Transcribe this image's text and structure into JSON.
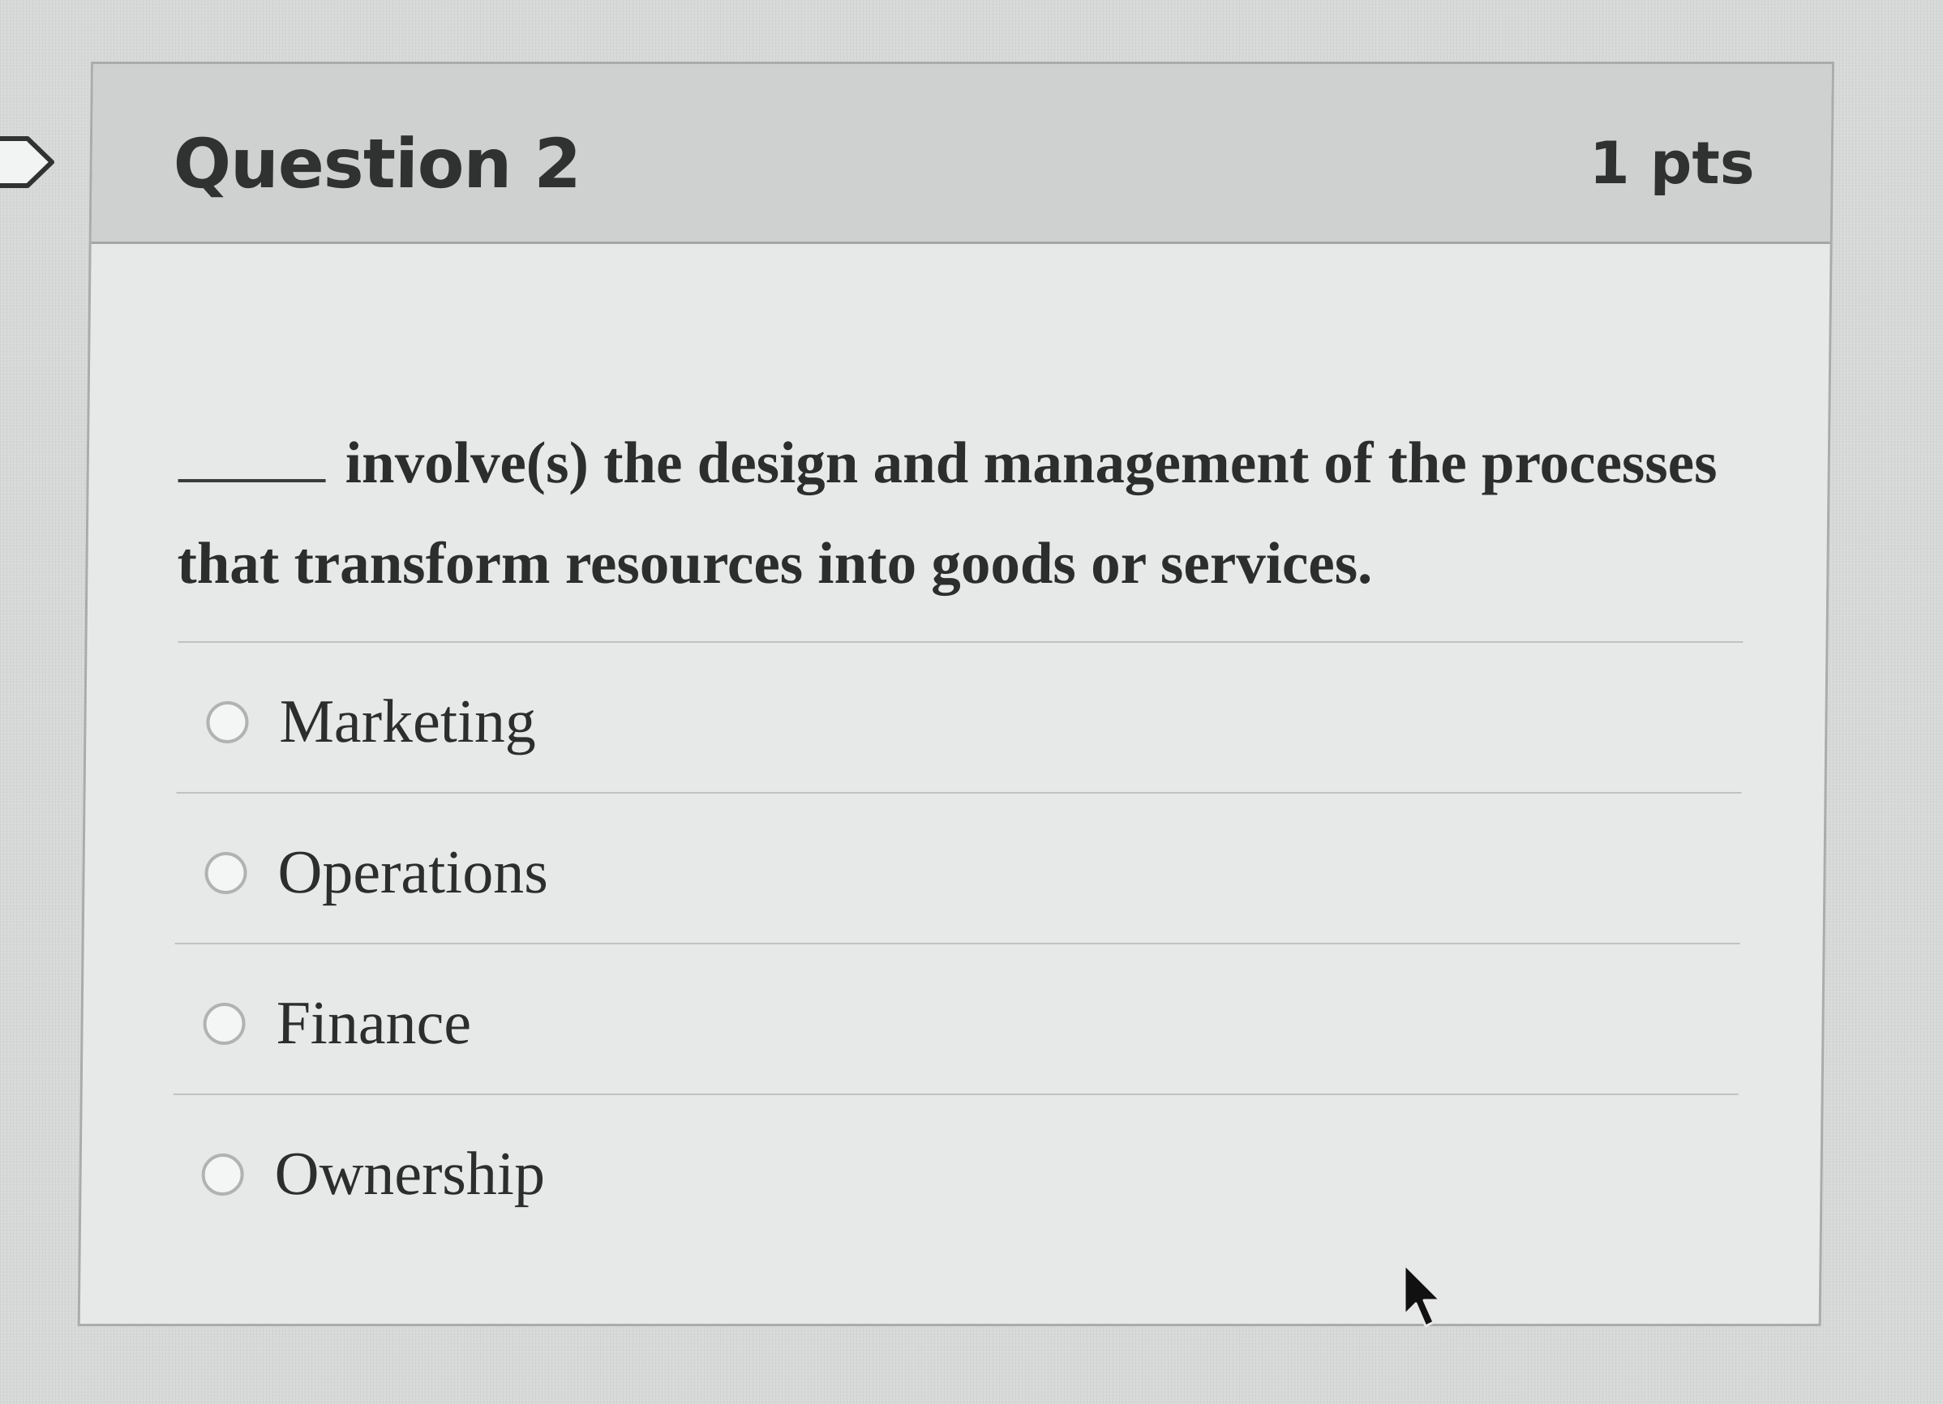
{
  "question": {
    "title": "Question 2",
    "points": "1 pts",
    "prompt": "involve(s) the design and management of the processes that transform resources into goods or services."
  },
  "answers": [
    {
      "label": "Marketing"
    },
    {
      "label": "Operations"
    },
    {
      "label": "Finance"
    },
    {
      "label": "Ownership"
    }
  ],
  "icons": {
    "flag": "flag-icon",
    "cursor": "mouse-pointer-icon"
  }
}
